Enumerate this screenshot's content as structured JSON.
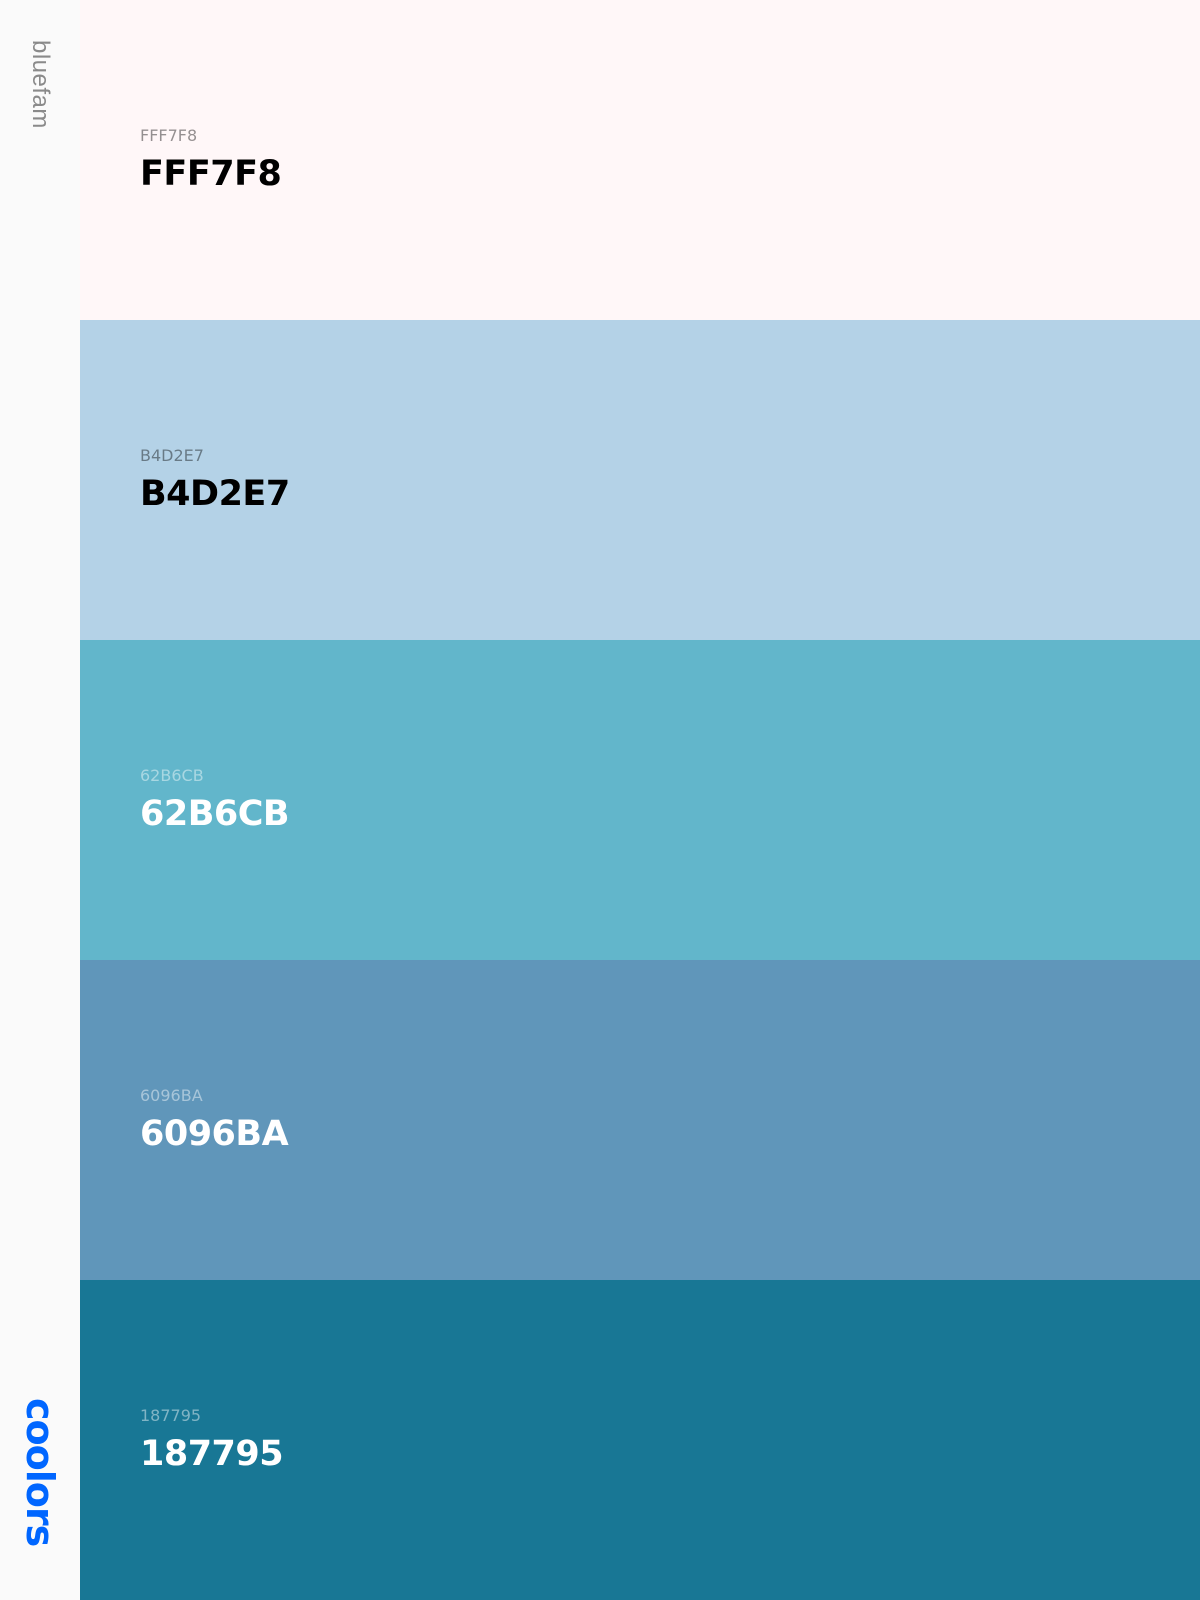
{
  "sidebar": {
    "palette_name": "bluefam",
    "brand": "coolors",
    "brand_color": "#0066ff"
  },
  "swatches": [
    {
      "hex_small": "FFF7F8",
      "hex_large": "FFF7F8",
      "color": "#FFF7F8",
      "tone": "light"
    },
    {
      "hex_small": "B4D2E7",
      "hex_large": "B4D2E7",
      "color": "#B4D2E7",
      "tone": "light"
    },
    {
      "hex_small": "62B6CB",
      "hex_large": "62B6CB",
      "color": "#62B6CB",
      "tone": "dark"
    },
    {
      "hex_small": "6096BA",
      "hex_large": "6096BA",
      "color": "#6096BA",
      "tone": "dark"
    },
    {
      "hex_small": "187795",
      "hex_large": "187795",
      "color": "#187795",
      "tone": "dark"
    }
  ]
}
